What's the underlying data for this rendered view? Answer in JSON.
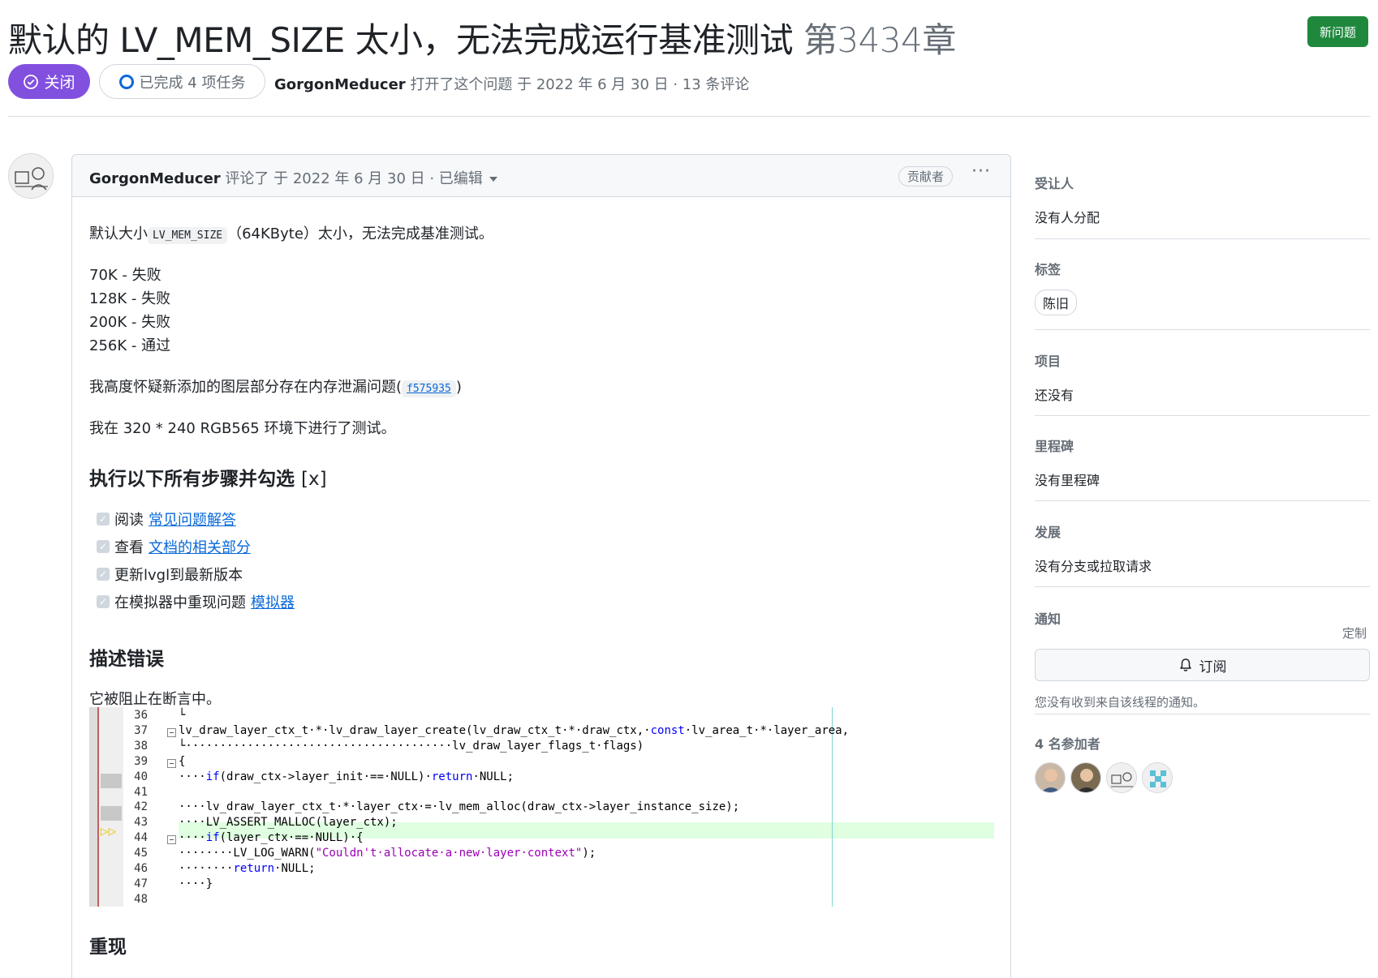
{
  "header": {
    "title": "默认的 LV_MEM_SIZE 太小，无法完成运行基准测试",
    "issue_number": "第3434章",
    "new_issue_label": "新问题",
    "state_label": "关闭",
    "tasks_label": "已完成 4 项任务",
    "meta_author": "GorgonMeducer",
    "meta_text": "打开了这个问题 于 2022 年 6 月 30 日 · 13 条评论"
  },
  "comment": {
    "author": "GorgonMeducer",
    "action": "评论了 于 2022 年 6 月 30 日 · 已编辑",
    "role_badge": "贡献者",
    "more_label": "···",
    "p1_before": "默认大小",
    "p1_code": "LV_MEM_SIZE",
    "p1_after": "（64KByte）太小，无法完成基准测试。",
    "results": [
      "70K - 失败",
      "128K - 失败",
      "200K - 失败",
      "256K - 通过"
    ],
    "p2_before": "我高度怀疑新添加的图层部分存在内存泄漏问题(",
    "p2_commit": "f575935",
    "p2_after": ")",
    "p3": "我在 320 * 240 RGB565 环境下进行了测试。",
    "h_steps": "执行以下所有步骤并勾选",
    "h_steps_suffix": "[x]",
    "tasks": [
      {
        "text": "阅读",
        "link": "常见问题解答"
      },
      {
        "text": "查看",
        "link": "文档的相关部分"
      },
      {
        "text": "更新lvgl到最新版本",
        "link": ""
      },
      {
        "text": "在模拟器中重现问题",
        "link": "模拟器"
      }
    ],
    "h_bug": "描述错误",
    "bug_text": "它被阻止在断言中。",
    "h_repro": "重现"
  },
  "code_screenshot": {
    "lines": [
      {
        "n": "36",
        "code": "└"
      },
      {
        "n": "37",
        "code": "lv_draw_layer_ctx_t·*·lv_draw_layer_create(lv_draw_ctx_t·*·draw_ctx,·const·lv_area_t·*·layer_area,"
      },
      {
        "n": "38",
        "code": "└·······································lv_draw_layer_flags_t·flags)"
      },
      {
        "n": "39",
        "code": "{"
      },
      {
        "n": "40",
        "code": "····if(draw_ctx->layer_init·==·NULL)·return·NULL;"
      },
      {
        "n": "41",
        "code": ""
      },
      {
        "n": "42",
        "code": "····lv_draw_layer_ctx_t·*·layer_ctx·=·lv_mem_alloc(draw_ctx->layer_instance_size);"
      },
      {
        "n": "43",
        "code": "····LV_ASSERT_MALLOC(layer_ctx);"
      },
      {
        "n": "44",
        "code": "····if(layer_ctx·==·NULL)·{"
      },
      {
        "n": "45",
        "code": "········LV_LOG_WARN(\"Couldn't·allocate·a·new·layer·context\");"
      },
      {
        "n": "46",
        "code": "········return·NULL;"
      },
      {
        "n": "47",
        "code": "····}"
      },
      {
        "n": "48",
        "code": ""
      }
    ]
  },
  "sidebar": {
    "assignees_h": "受让人",
    "assignees_v": "没有人分配",
    "labels_h": "标签",
    "label_pill": "陈旧",
    "projects_h": "项目",
    "projects_v": "还没有",
    "milestone_h": "里程碑",
    "milestone_v": "没有里程碑",
    "dev_h": "发展",
    "dev_v": "没有分支或拉取请求",
    "notif_h": "通知",
    "customize": "定制",
    "subscribe": "订阅",
    "notif_note": "您没有收到来自该线程的通知。",
    "participants_h": "4 名参加者"
  },
  "colors": {
    "closed_purple": "#8250df",
    "primary_green": "#1f883d",
    "link_blue": "#0969da"
  }
}
